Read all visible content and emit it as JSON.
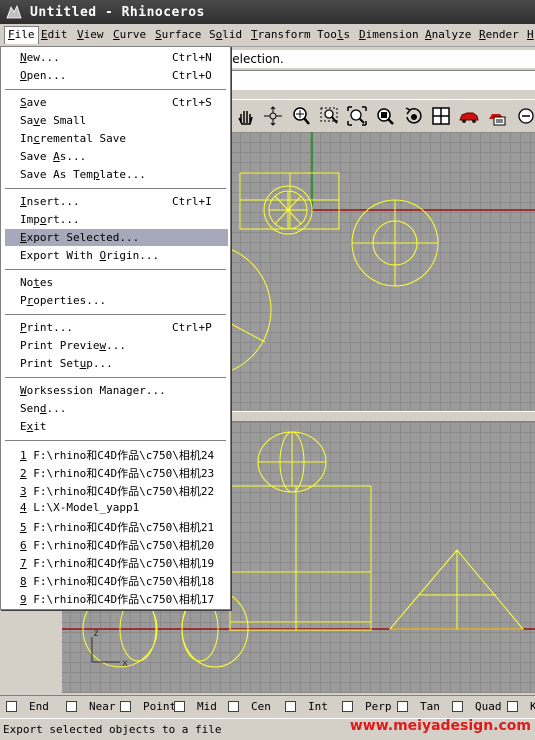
{
  "window": {
    "title": "Untitled - Rhinoceros"
  },
  "menubar": [
    {
      "label": "File",
      "ul": 0
    },
    {
      "label": "Edit",
      "ul": 0
    },
    {
      "label": "View",
      "ul": 0
    },
    {
      "label": "Curve",
      "ul": 0
    },
    {
      "label": "Surface",
      "ul": 0
    },
    {
      "label": "Solid",
      "ul": 1
    },
    {
      "label": "Transform",
      "ul": 0
    },
    {
      "label": "Tools",
      "ul": 3
    },
    {
      "label": "Dimension",
      "ul": 0
    },
    {
      "label": "Analyze",
      "ul": 0
    },
    {
      "label": "Render",
      "ul": 0
    },
    {
      "label": "H",
      "ul": 0
    }
  ],
  "command_line": {
    "text": "selection."
  },
  "toolbar": {
    "icons": [
      "pan-hand-icon",
      "rotate-view-icon",
      "zoom-dynamic-icon",
      "zoom-window-icon",
      "zoom-extents-icon",
      "zoom-selected-icon",
      "undo-view-icon",
      "four-viewports-icon",
      "render-car-icon",
      "render-options-icon",
      "more-icon"
    ]
  },
  "file_menu": {
    "groups": [
      [
        {
          "label": "New...",
          "ul": 0,
          "acc": "Ctrl+N"
        },
        {
          "label": "Open...",
          "ul": 0,
          "acc": "Ctrl+O"
        }
      ],
      [
        {
          "label": "Save",
          "ul": 0,
          "acc": "Ctrl+S"
        },
        {
          "label": "Save Small",
          "ul": 2,
          "acc": ""
        },
        {
          "label": "Incremental Save",
          "ul": 2,
          "acc": ""
        },
        {
          "label": "Save As...",
          "ul": 5,
          "acc": ""
        },
        {
          "label": "Save As Template...",
          "ul": 11,
          "acc": ""
        }
      ],
      [
        {
          "label": "Insert...",
          "ul": 0,
          "acc": "Ctrl+I"
        },
        {
          "label": "Import...",
          "ul": 3,
          "acc": ""
        },
        {
          "label": "Export Selected...",
          "ul": 0,
          "acc": "",
          "hl": true
        },
        {
          "label": "Export With Origin...",
          "ul": 12,
          "acc": ""
        }
      ],
      [
        {
          "label": "Notes",
          "ul": 2,
          "acc": ""
        },
        {
          "label": "Properties...",
          "ul": 1,
          "acc": ""
        }
      ],
      [
        {
          "label": "Print...",
          "ul": 0,
          "acc": "Ctrl+P"
        },
        {
          "label": "Print Preview...",
          "ul": 12,
          "acc": ""
        },
        {
          "label": "Print Setup...",
          "ul": 9,
          "acc": ""
        }
      ],
      [
        {
          "label": "Worksession Manager...",
          "ul": 0,
          "acc": ""
        },
        {
          "label": "Send...",
          "ul": 3,
          "acc": ""
        },
        {
          "label": "Exit",
          "ul": 1,
          "acc": ""
        }
      ],
      [
        {
          "label": "1 F:\\rhino和C4D作品\\c750\\相机24",
          "ul": 0,
          "acc": ""
        },
        {
          "label": "2 F:\\rhino和C4D作品\\c750\\相机23",
          "ul": 0,
          "acc": ""
        },
        {
          "label": "3 F:\\rhino和C4D作品\\c750\\相机22",
          "ul": 0,
          "acc": ""
        },
        {
          "label": "4 L:\\X-Model_yapp1",
          "ul": 0,
          "acc": ""
        },
        {
          "label": "5 F:\\rhino和C4D作品\\c750\\相机21",
          "ul": 0,
          "acc": ""
        },
        {
          "label": "6 F:\\rhino和C4D作品\\c750\\相机20",
          "ul": 0,
          "acc": ""
        },
        {
          "label": "7 F:\\rhino和C4D作品\\c750\\相机19",
          "ul": 0,
          "acc": ""
        },
        {
          "label": "8 F:\\rhino和C4D作品\\c750\\相机18",
          "ul": 0,
          "acc": ""
        },
        {
          "label": "9 F:\\rhino和C4D作品\\c750\\相机17",
          "ul": 0,
          "acc": ""
        }
      ]
    ]
  },
  "viewport": {
    "axis_x": "x",
    "axis_z": "z",
    "curve_color": "#ffff33",
    "grid_color": "#9b9b9b",
    "x_axis_color": "#a01010",
    "y_axis_color": "#10a010"
  },
  "osnaps": [
    "End",
    "Near",
    "Point",
    "Mid",
    "Cen",
    "Int",
    "Perp",
    "Tan",
    "Quad",
    "Kn"
  ],
  "status": {
    "text": "Export selected objects to a file",
    "watermark": "www.meiyadesign.com"
  },
  "colors": {
    "menu_highlight": "#a8a8bb",
    "watermark": "#e01919",
    "chrome": "#d4d0c8"
  }
}
